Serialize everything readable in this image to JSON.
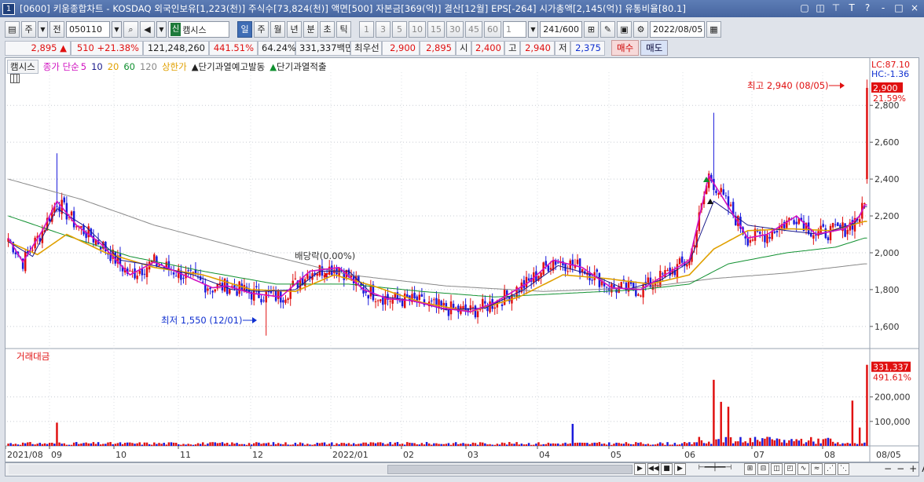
{
  "window": {
    "num": "1",
    "title": "[0600] 키움종합차트 - KOSDAQ 외국인보유[1,223(천)] 주식수[73,824(천)] 액면[500] 자본금[369(억)] 결산[12월] EPS[-264] 시가총액[2,145(억)] 유통비율[80.1]",
    "controls": [
      "▢",
      "◫",
      "⊤",
      "T",
      "?",
      "-",
      "□",
      "×"
    ]
  },
  "toolbar": {
    "period_type": "주",
    "all_btn": "전",
    "code": "050110",
    "sin_badge": "신",
    "stock_name": "캠시스",
    "intervals": [
      "일",
      "주",
      "월",
      "년",
      "분",
      "초",
      "틱"
    ],
    "selected_interval": "일",
    "minutes": [
      "1",
      "3",
      "5",
      "10",
      "15",
      "30",
      "45",
      "60"
    ],
    "count_value": "1",
    "range": "241",
    "range_total": "/600",
    "date": "2022/08/05"
  },
  "quote": {
    "price": "2,895",
    "arrow": "▲",
    "change": "510",
    "change_pct": "+21.38%",
    "volume": "121,248,260",
    "vol_ratio": "441.51%",
    "turnover": "64.24%",
    "amount": "331,337백만",
    "best_label": "최우선",
    "ask": "2,900",
    "bid": "2,895",
    "open_label": "시",
    "open": "2,400",
    "high_label": "고",
    "high": "2,940",
    "low_label": "저",
    "low": "2,375",
    "buy_btn": "매수",
    "sell_btn": "매도"
  },
  "legend": {
    "name": "캠시스",
    "ma_label": "종가 단순",
    "ma5": "5",
    "ma10": "10",
    "ma20": "20",
    "ma60": "60",
    "ma120": "120",
    "limit_up": "상한가",
    "warn": "단기과열예고발동",
    "applied": "단기과열적출",
    "volume_title": "거래대금"
  },
  "right_labels": {
    "lc": "LC:87.10",
    "hc": "HC:-1.36",
    "last_price": "2,900",
    "last_pct": "21.59%",
    "last_vol": "331,337",
    "last_vol_pct": "491.61%"
  },
  "annotations": {
    "high": "최고 2,940 (08/05)",
    "low": "최저 1,550 (12/01)",
    "dividend": "배당락(0.00%)"
  },
  "colors": {
    "up": "#e01010",
    "down": "#1a1adc",
    "ma5": "#d010c0",
    "ma10": "#1a1a8a",
    "ma20": "#e0a000",
    "ma60": "#109030",
    "ma120": "#888888"
  },
  "chart_data": {
    "type": "candlestick",
    "price_axis": {
      "ticks": [
        1600,
        1800,
        2000,
        2200,
        2400,
        2600,
        2800
      ],
      "labels": [
        "1,600",
        "1,800",
        "2,000",
        "2,200",
        "2,400",
        "2,600",
        "2,800"
      ]
    },
    "volume_axis": {
      "ticks": [
        100000,
        200000
      ],
      "labels": [
        "100,000",
        "200,000"
      ]
    },
    "x_labels": [
      "2021/08",
      "09",
      "10",
      "11",
      "12",
      "2022/01",
      "02",
      "03",
      "04",
      "05",
      "06",
      "07",
      "08",
      "08/05"
    ],
    "ma_anchor_points": {
      "ma5": [
        [
          0,
          2080
        ],
        [
          6,
          1950
        ],
        [
          14,
          2120
        ],
        [
          20,
          2280
        ],
        [
          28,
          2150
        ],
        [
          38,
          2050
        ],
        [
          50,
          1880
        ],
        [
          60,
          1950
        ],
        [
          72,
          1880
        ],
        [
          84,
          1810
        ],
        [
          90,
          1820
        ],
        [
          100,
          1780
        ],
        [
          112,
          1760
        ],
        [
          124,
          1900
        ],
        [
          136,
          1920
        ],
        [
          146,
          1800
        ],
        [
          156,
          1750
        ],
        [
          166,
          1740
        ],
        [
          178,
          1700
        ],
        [
          190,
          1680
        ],
        [
          200,
          1730
        ],
        [
          214,
          1840
        ],
        [
          224,
          1960
        ],
        [
          236,
          1920
        ],
        [
          248,
          1810
        ],
        [
          260,
          1800
        ],
        [
          270,
          1880
        ],
        [
          280,
          1960
        ],
        [
          288,
          2420
        ],
        [
          296,
          2250
        ],
        [
          304,
          2080
        ],
        [
          312,
          2100
        ],
        [
          324,
          2200
        ],
        [
          332,
          2100
        ],
        [
          344,
          2130
        ],
        [
          350,
          2200
        ],
        [
          352,
          2260
        ]
      ],
      "ma10": [
        [
          0,
          2060
        ],
        [
          10,
          1980
        ],
        [
          20,
          2240
        ],
        [
          32,
          2140
        ],
        [
          46,
          1960
        ],
        [
          60,
          1930
        ],
        [
          76,
          1880
        ],
        [
          92,
          1800
        ],
        [
          104,
          1790
        ],
        [
          118,
          1800
        ],
        [
          128,
          1900
        ],
        [
          140,
          1900
        ],
        [
          150,
          1770
        ],
        [
          166,
          1740
        ],
        [
          180,
          1690
        ],
        [
          196,
          1700
        ],
        [
          212,
          1800
        ],
        [
          226,
          1930
        ],
        [
          240,
          1880
        ],
        [
          254,
          1800
        ],
        [
          268,
          1850
        ],
        [
          280,
          1950
        ],
        [
          290,
          2280
        ],
        [
          304,
          2150
        ],
        [
          320,
          2120
        ],
        [
          334,
          2100
        ],
        [
          348,
          2160
        ],
        [
          352,
          2250
        ]
      ],
      "ma20": [
        [
          0,
          2060
        ],
        [
          12,
          1990
        ],
        [
          24,
          2100
        ],
        [
          40,
          2000
        ],
        [
          60,
          1920
        ],
        [
          80,
          1880
        ],
        [
          100,
          1800
        ],
        [
          118,
          1790
        ],
        [
          134,
          1880
        ],
        [
          150,
          1820
        ],
        [
          170,
          1730
        ],
        [
          190,
          1680
        ],
        [
          210,
          1760
        ],
        [
          228,
          1880
        ],
        [
          246,
          1860
        ],
        [
          264,
          1830
        ],
        [
          280,
          1880
        ],
        [
          290,
          2020
        ],
        [
          304,
          2120
        ],
        [
          322,
          2130
        ],
        [
          338,
          2120
        ],
        [
          352,
          2170
        ]
      ],
      "ma60": [
        [
          0,
          2200
        ],
        [
          20,
          2110
        ],
        [
          50,
          1980
        ],
        [
          80,
          1900
        ],
        [
          110,
          1830
        ],
        [
          140,
          1830
        ],
        [
          170,
          1790
        ],
        [
          200,
          1760
        ],
        [
          230,
          1780
        ],
        [
          260,
          1800
        ],
        [
          280,
          1830
        ],
        [
          296,
          1940
        ],
        [
          320,
          2000
        ],
        [
          340,
          2030
        ],
        [
          352,
          2080
        ]
      ],
      "ma120": [
        [
          0,
          2400
        ],
        [
          30,
          2290
        ],
        [
          60,
          2150
        ],
        [
          100,
          2010
        ],
        [
          140,
          1880
        ],
        [
          180,
          1820
        ],
        [
          220,
          1790
        ],
        [
          260,
          1810
        ],
        [
          290,
          1860
        ],
        [
          320,
          1890
        ],
        [
          352,
          1940
        ]
      ]
    }
  }
}
